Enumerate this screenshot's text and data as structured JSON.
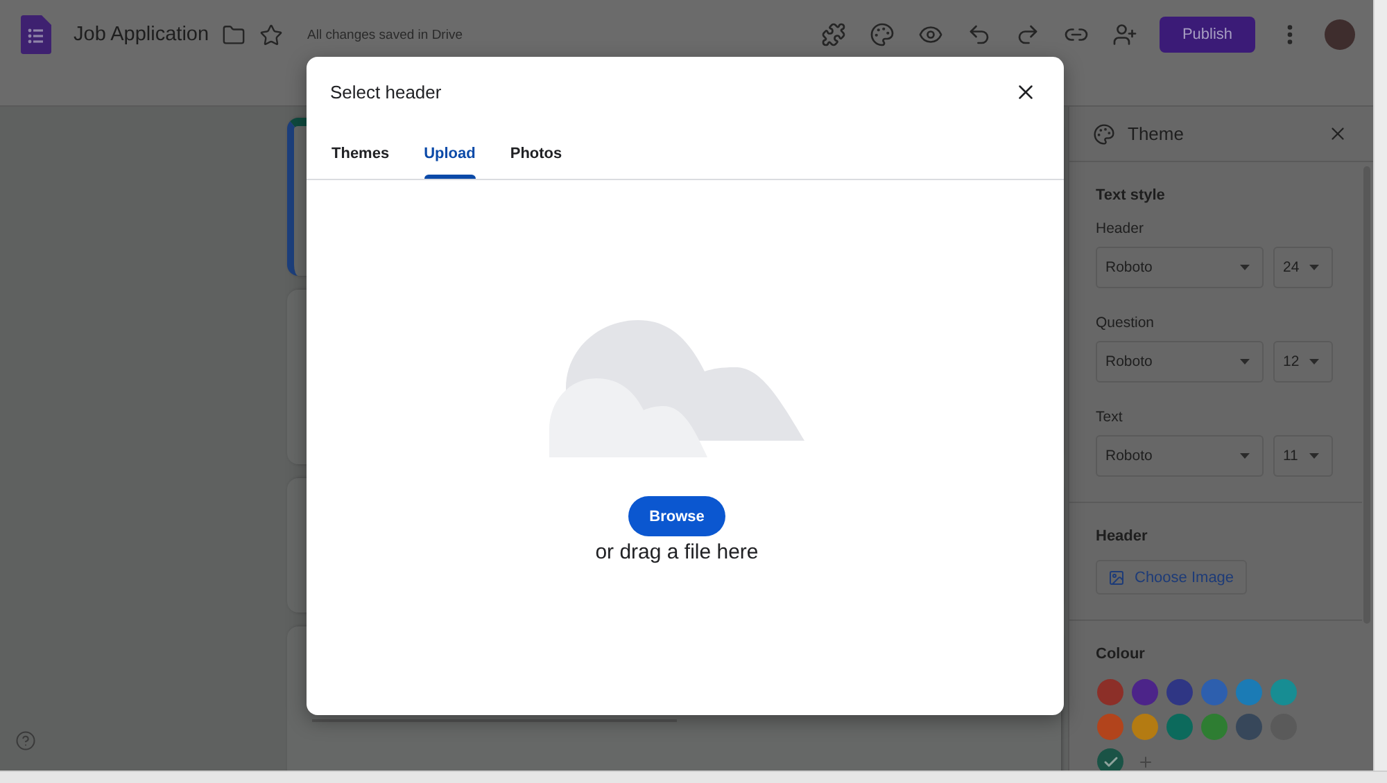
{
  "app_bar": {
    "title": "Job Application",
    "save_status": "All changes saved in Drive",
    "publish_button": "Publish"
  },
  "form_cards": [
    {
      "kind": "header",
      "selected": true
    },
    {
      "kind": "question",
      "selected": false
    },
    {
      "kind": "question",
      "selected": false
    },
    {
      "kind": "short_answer",
      "selected": false
    }
  ],
  "dialog": {
    "title": "Select header",
    "tabs": [
      {
        "label": "Themes",
        "selected": false
      },
      {
        "label": "Upload",
        "selected": true
      },
      {
        "label": "Photos",
        "selected": false
      }
    ],
    "browse_button": "Browse",
    "drop_hint": "or drag a file here"
  },
  "theme_panel": {
    "title": "Theme",
    "text_style": {
      "heading": "Text style",
      "rows": [
        {
          "label": "Header",
          "font": "Roboto",
          "size": "24"
        },
        {
          "label": "Question",
          "font": "Roboto",
          "size": "12"
        },
        {
          "label": "Text",
          "font": "Roboto",
          "size": "11"
        }
      ]
    },
    "header_image": {
      "heading": "Header",
      "button": "Choose Image"
    },
    "colour": {
      "heading": "Colour",
      "swatches": [
        {
          "color": "#8c2f28",
          "selected": false
        },
        {
          "color": "#4c2489",
          "selected": false
        },
        {
          "color": "#2f3684",
          "selected": false
        },
        {
          "color": "#2d5fae",
          "selected": false
        },
        {
          "color": "#1b7bb5",
          "selected": false
        },
        {
          "color": "#178d93",
          "selected": false
        },
        {
          "color": "#b2441c",
          "selected": false
        },
        {
          "color": "#b47b12",
          "selected": false
        },
        {
          "color": "#0c6a5c",
          "selected": false
        },
        {
          "color": "#2e7d32",
          "selected": false
        },
        {
          "color": "#37475a",
          "selected": false
        },
        {
          "color": "#5a5a5a",
          "selected": false
        },
        {
          "color": "#1a5346",
          "selected": true
        }
      ]
    }
  }
}
